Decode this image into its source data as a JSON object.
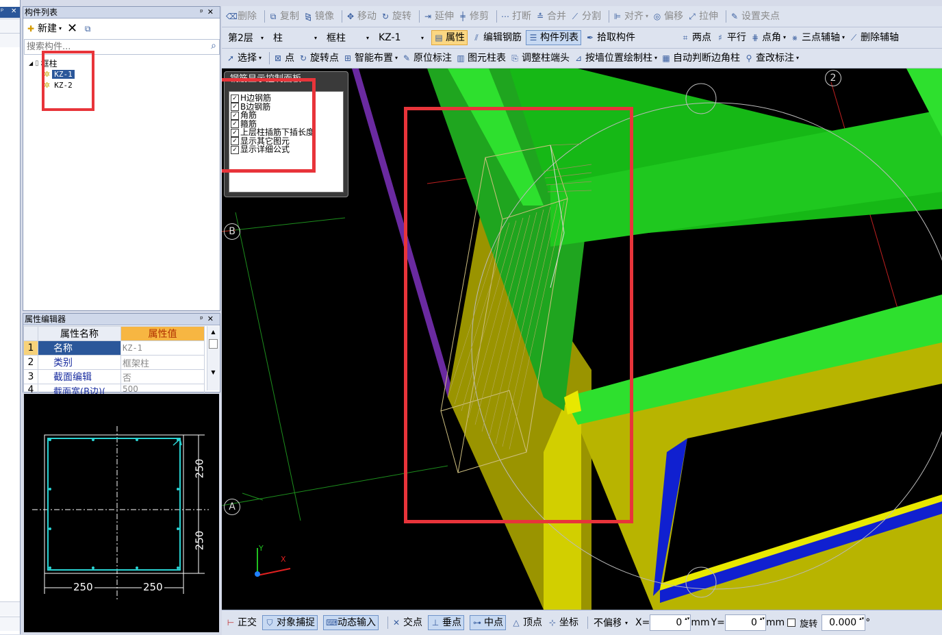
{
  "left_strip": {
    "close": "✕"
  },
  "component_panel": {
    "title": "构件列表",
    "pin": "📌",
    "close": "✕",
    "new_label": "新建",
    "search_placeholder": "搜索构件...",
    "tree": {
      "root": "框柱",
      "items": [
        {
          "label": "KZ-1",
          "selected": true
        },
        {
          "label": "KZ-2",
          "selected": false
        }
      ]
    }
  },
  "property_panel": {
    "title": "属性编辑器",
    "col_name": "属性名称",
    "col_value": "属性值",
    "rows": [
      {
        "num": "1",
        "name": "名称",
        "value": "KZ-1"
      },
      {
        "num": "2",
        "name": "类别",
        "value": "框架柱"
      },
      {
        "num": "3",
        "name": "截面编辑",
        "value": "否"
      },
      {
        "num": "4",
        "name": "截面宽(B边)(",
        "value": "500"
      }
    ]
  },
  "section_preview": {
    "dim_h1": "250",
    "dim_h2": "250",
    "dim_w1": "250",
    "dim_w2": "250"
  },
  "toolbar1": {
    "items": [
      "删除",
      "复制",
      "镜像",
      "移动",
      "旋转",
      "延伸",
      "修剪",
      "打断",
      "合并",
      "分割",
      "对齐",
      "偏移",
      "拉伸",
      "设置夹点"
    ]
  },
  "toolbar2": {
    "floor": "第2层",
    "type": "柱",
    "subtype": "框柱",
    "component": "KZ-1",
    "properties": "属性",
    "edit_rebar": "编辑钢筋",
    "component_list": "构件列表",
    "pick": "拾取构件",
    "two_points": "两点",
    "parallel": "平行",
    "point_angle": "点角",
    "three_point_axis": "三点辅轴",
    "delete_axis": "删除辅轴"
  },
  "toolbar3": {
    "select": "选择",
    "point": "点",
    "rotate_point": "旋转点",
    "smart_layout": "智能布置",
    "in_situ_label": "原位标注",
    "element_table": "图元柱表",
    "adjust_head": "调整柱端头",
    "draw_by_wall": "按墙位置绘制柱",
    "auto_corner": "自动判断边角柱",
    "check_label": "查改标注"
  },
  "rebar_panel": {
    "title": "钢筋显示控制面板",
    "options": [
      {
        "label": "H边钢筋",
        "checked": true
      },
      {
        "label": "B边钢筋",
        "checked": true
      },
      {
        "label": "角筋",
        "checked": true
      },
      {
        "label": "箍筋",
        "checked": true
      },
      {
        "label": "上层柱插筋下插长度",
        "checked": true
      },
      {
        "label": "显示其它图元",
        "checked": true
      },
      {
        "label": "显示详细公式",
        "checked": true
      }
    ]
  },
  "viewport": {
    "axis_b": "B",
    "axis_a": "A",
    "axis_2": "2",
    "ucs_x": "X",
    "ucs_y": "Y"
  },
  "statusbar": {
    "ortho": "正交",
    "snap": "对象捕捉",
    "dyn_input": "动态输入",
    "intersection": "交点",
    "perpendicular": "垂点",
    "midpoint": "中点",
    "vertex": "顶点",
    "coordinate": "坐标",
    "offset_mode": "不偏移",
    "x_label": "X=",
    "x_value": "0",
    "mm1": "mm",
    "y_label": "Y=",
    "y_value": "0",
    "mm2": "mm",
    "rotate_label": "旋转",
    "rotate_value": "0.000",
    "degree": "°"
  },
  "colors": {
    "highlight_red": "#e8343a",
    "beam_green": "#22dd22",
    "wall_yellow": "#c8c800",
    "rebar_line": "#cfc080"
  }
}
